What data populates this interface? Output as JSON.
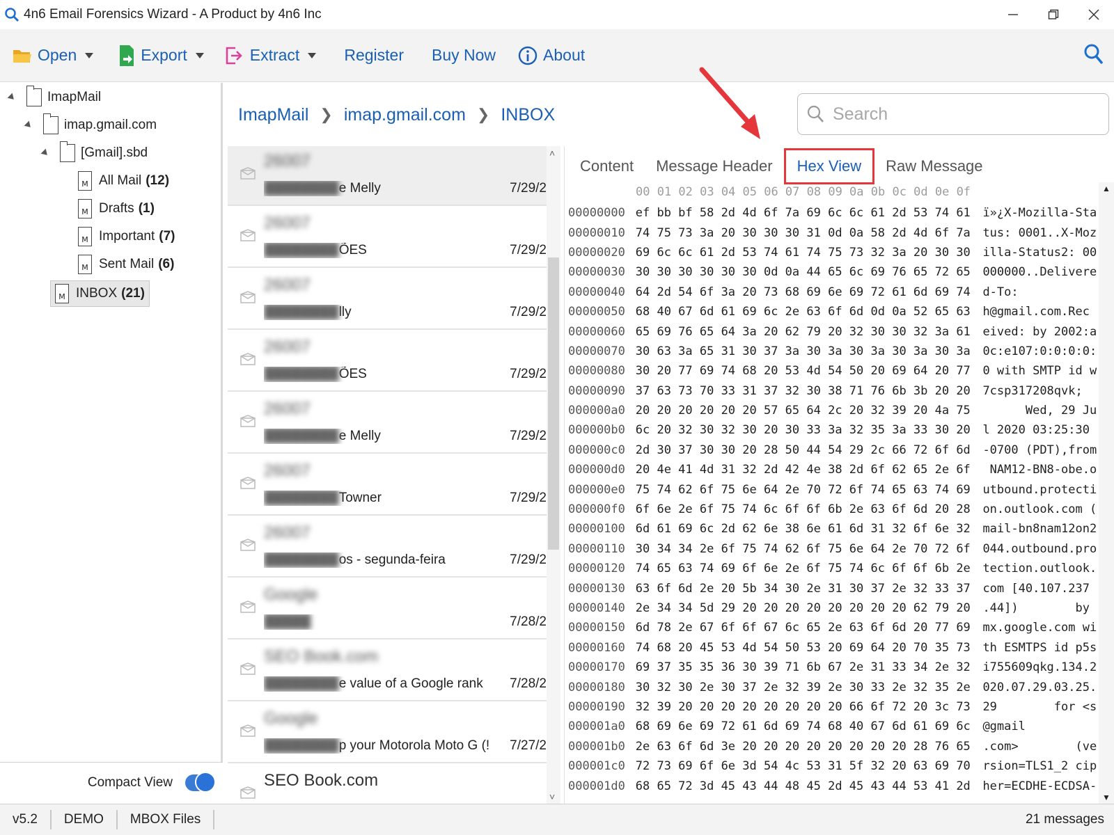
{
  "window": {
    "title": "4n6 Email Forensics Wizard - A Product by 4n6 Inc",
    "icon": "magnifier-icon",
    "controls": [
      "minimize-icon",
      "restore-icon",
      "close-icon"
    ]
  },
  "toolbar": {
    "open_label": "Open",
    "export_label": "Export",
    "extract_label": "Extract",
    "register_label": "Register",
    "buynow_label": "Buy Now",
    "about_label": "About",
    "accent": "#1a5fb4"
  },
  "tree": {
    "root": "ImapMail",
    "account": "imap.gmail.com",
    "folder": "[Gmail].sbd",
    "items": [
      {
        "label": "All Mail",
        "count": "(12)"
      },
      {
        "label": "Drafts",
        "count": "(1)"
      },
      {
        "label": "Important",
        "count": "(7)"
      },
      {
        "label": "Sent Mail",
        "count": "(6)"
      }
    ],
    "inbox": {
      "label": "INBOX",
      "count": "(21)"
    }
  },
  "compact_view": {
    "label": "Compact View",
    "enabled": true
  },
  "breadcrumb": [
    "ImapMail",
    "imap.gmail.com",
    "INBOX"
  ],
  "search": {
    "placeholder": "Search"
  },
  "messages": [
    {
      "sender": "26007",
      "subject": "e Melly",
      "date": "7/29/2"
    },
    {
      "sender": "26007",
      "subject": "ÕES",
      "date": "7/29/2"
    },
    {
      "sender": "26007",
      "subject": "lly",
      "date": "7/29/2"
    },
    {
      "sender": "26007",
      "subject": "ÕES",
      "date": "7/29/2"
    },
    {
      "sender": "26007",
      "subject": "e Melly",
      "date": "7/29/2"
    },
    {
      "sender": "26007",
      "subject": "Towner",
      "date": "7/29/2"
    },
    {
      "sender": "26007",
      "subject": "os - segunda-feira",
      "date": "7/29/2"
    },
    {
      "sender": "Google",
      "subject": "",
      "date": "7/28/2"
    },
    {
      "sender": "SEO Book.com",
      "subject": "e value of a Google rank",
      "date": "7/28/2"
    },
    {
      "sender": "Google",
      "subject": "p your Motorola Moto G (!",
      "date": "7/27/2"
    },
    {
      "sender": "SEO Book.com",
      "subject": "",
      "date": ""
    }
  ],
  "preview": {
    "tabs": [
      "Content",
      "Message Header",
      "Hex View",
      "Raw Message"
    ],
    "active_tab": "Hex View",
    "hex_header": "00 01 02 03 04 05 06 07 08 09 0a 0b 0c 0d 0e 0f",
    "rows": [
      {
        "off": "00000000",
        "bytes": "ef bb bf 58 2d 4d 6f 7a 69 6c 6c 61 2d 53 74 61",
        "ascii": "ï»¿X-Mozilla-Sta"
      },
      {
        "off": "00000010",
        "bytes": "74 75 73 3a 20 30 30 30 31 0d 0a 58 2d 4d 6f 7a",
        "ascii": "tus: 0001..X-Moz"
      },
      {
        "off": "00000020",
        "bytes": "69 6c 6c 61 2d 53 74 61 74 75 73 32 3a 20 30 30",
        "ascii": "illa-Status2: 00"
      },
      {
        "off": "00000030",
        "bytes": "30 30 30 30 30 30 0d 0a 44 65 6c 69 76 65 72 65",
        "ascii": "000000..Delivere"
      },
      {
        "off": "00000040",
        "bytes": "64 2d 54 6f 3a 20 73 68 69 6e 69 72 61 6d 69 74",
        "ascii": "d-To:"
      },
      {
        "off": "00000050",
        "bytes": "68 40 67 6d 61 69 6c 2e 63 6f 6d 0d 0a 52 65 63",
        "ascii": "h@gmail.com.Rec"
      },
      {
        "off": "00000060",
        "bytes": "65 69 76 65 64 3a 20 62 79 20 32 30 30 32 3a 61",
        "ascii": "eived: by 2002:a"
      },
      {
        "off": "00000070",
        "bytes": "30 63 3a 65 31 30 37 3a 30 3a 30 3a 30 3a 30 3a",
        "ascii": "0c:e107:0:0:0:0:"
      },
      {
        "off": "00000080",
        "bytes": "30 20 77 69 74 68 20 53 4d 54 50 20 69 64 20 77",
        "ascii": "0 with SMTP id w"
      },
      {
        "off": "00000090",
        "bytes": "37 63 73 70 33 31 37 32 30 38 71 76 6b 3b 20 20",
        "ascii": "7csp317208qvk;"
      },
      {
        "off": "000000a0",
        "bytes": "20 20 20 20 20 20 57 65 64 2c 20 32 39 20 4a 75",
        "ascii": "      Wed, 29 Ju"
      },
      {
        "off": "000000b0",
        "bytes": "6c 20 32 30 32 30 20 30 33 3a 32 35 3a 33 30 20",
        "ascii": "l 2020 03:25:30"
      },
      {
        "off": "000000c0",
        "bytes": "2d 30 37 30 30 20 28 50 44 54 29 2c 66 72 6f 6d",
        "ascii": "-0700 (PDT),from"
      },
      {
        "off": "000000d0",
        "bytes": "20 4e 41 4d 31 32 2d 42 4e 38 2d 6f 62 65 2e 6f",
        "ascii": " NAM12-BN8-obe.o"
      },
      {
        "off": "000000e0",
        "bytes": "75 74 62 6f 75 6e 64 2e 70 72 6f 74 65 63 74 69",
        "ascii": "utbound.protecti"
      },
      {
        "off": "000000f0",
        "bytes": "6f 6e 2e 6f 75 74 6c 6f 6f 6b 2e 63 6f 6d 20 28",
        "ascii": "on.outlook.com ("
      },
      {
        "off": "00000100",
        "bytes": "6d 61 69 6c 2d 62 6e 38 6e 61 6d 31 32 6f 6e 32",
        "ascii": "mail-bn8nam12on2"
      },
      {
        "off": "00000110",
        "bytes": "30 34 34 2e 6f 75 74 62 6f 75 6e 64 2e 70 72 6f",
        "ascii": "044.outbound.pro"
      },
      {
        "off": "00000120",
        "bytes": "74 65 63 74 69 6f 6e 2e 6f 75 74 6c 6f 6f 6b 2e",
        "ascii": "tection.outlook."
      },
      {
        "off": "00000130",
        "bytes": "63 6f 6d 2e 20 5b 34 30 2e 31 30 37 2e 32 33 37",
        "ascii": "com [40.107.237"
      },
      {
        "off": "00000140",
        "bytes": "2e 34 34 5d 29 20 20 20 20 20 20 20 20 62 79 20",
        "ascii": ".44])        by"
      },
      {
        "off": "00000150",
        "bytes": "6d 78 2e 67 6f 6f 67 6c 65 2e 63 6f 6d 20 77 69",
        "ascii": "mx.google.com wi"
      },
      {
        "off": "00000160",
        "bytes": "74 68 20 45 53 4d 54 50 53 20 69 64 20 70 35 73",
        "ascii": "th ESMTPS id p5s"
      },
      {
        "off": "00000170",
        "bytes": "69 37 35 35 36 30 39 71 6b 67 2e 31 33 34 2e 32",
        "ascii": "i755609qkg.134.2"
      },
      {
        "off": "00000180",
        "bytes": "30 32 30 2e 30 37 2e 32 39 2e 30 33 2e 32 35 2e",
        "ascii": "020.07.29.03.25."
      },
      {
        "off": "00000190",
        "bytes": "32 39 20 20 20 20 20 20 20 20 66 6f 72 20 3c 73",
        "ascii": "29        for <s"
      },
      {
        "off": "000001a0",
        "bytes": "68 69 6e 69 72 61 6d 69 74 68 40 67 6d 61 69 6c",
        "ascii": "@gmail"
      },
      {
        "off": "000001b0",
        "bytes": "2e 63 6f 6d 3e 20 20 20 20 20 20 20 20 28 76 65",
        "ascii": ".com>        (ve"
      },
      {
        "off": "000001c0",
        "bytes": "72 73 69 6f 6e 3d 54 4c 53 31 5f 32 20 63 69 70",
        "ascii": "rsion=TLS1_2 cip"
      },
      {
        "off": "000001d0",
        "bytes": "68 65 72 3d 45 43 44 48 45 2d 45 43 44 53 41 2d",
        "ascii": "her=ECDHE-ECDSA-"
      }
    ]
  },
  "status": {
    "version": "v5.2",
    "mode": "DEMO",
    "file_type": "MBOX Files",
    "count": "21 messages"
  },
  "annotation": {
    "color": "#e4363b"
  }
}
